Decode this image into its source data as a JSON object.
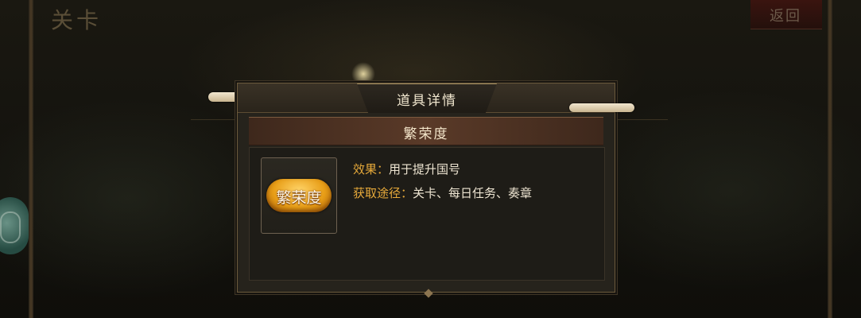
{
  "background": {
    "title": "关卡",
    "return_label": "返回"
  },
  "modal": {
    "title": "道具详情",
    "item_name": "繁荣度",
    "item_badge_text": "繁荣度",
    "effect_label": "效果：",
    "effect_value": "用于提升国号",
    "source_label": "获取途径：",
    "source_value": "关卡、每日任务、奏章"
  },
  "colors": {
    "label_orange": "#e6a93a",
    "title_cream": "#f1e7cf",
    "badge_gold": "#e89e17"
  }
}
